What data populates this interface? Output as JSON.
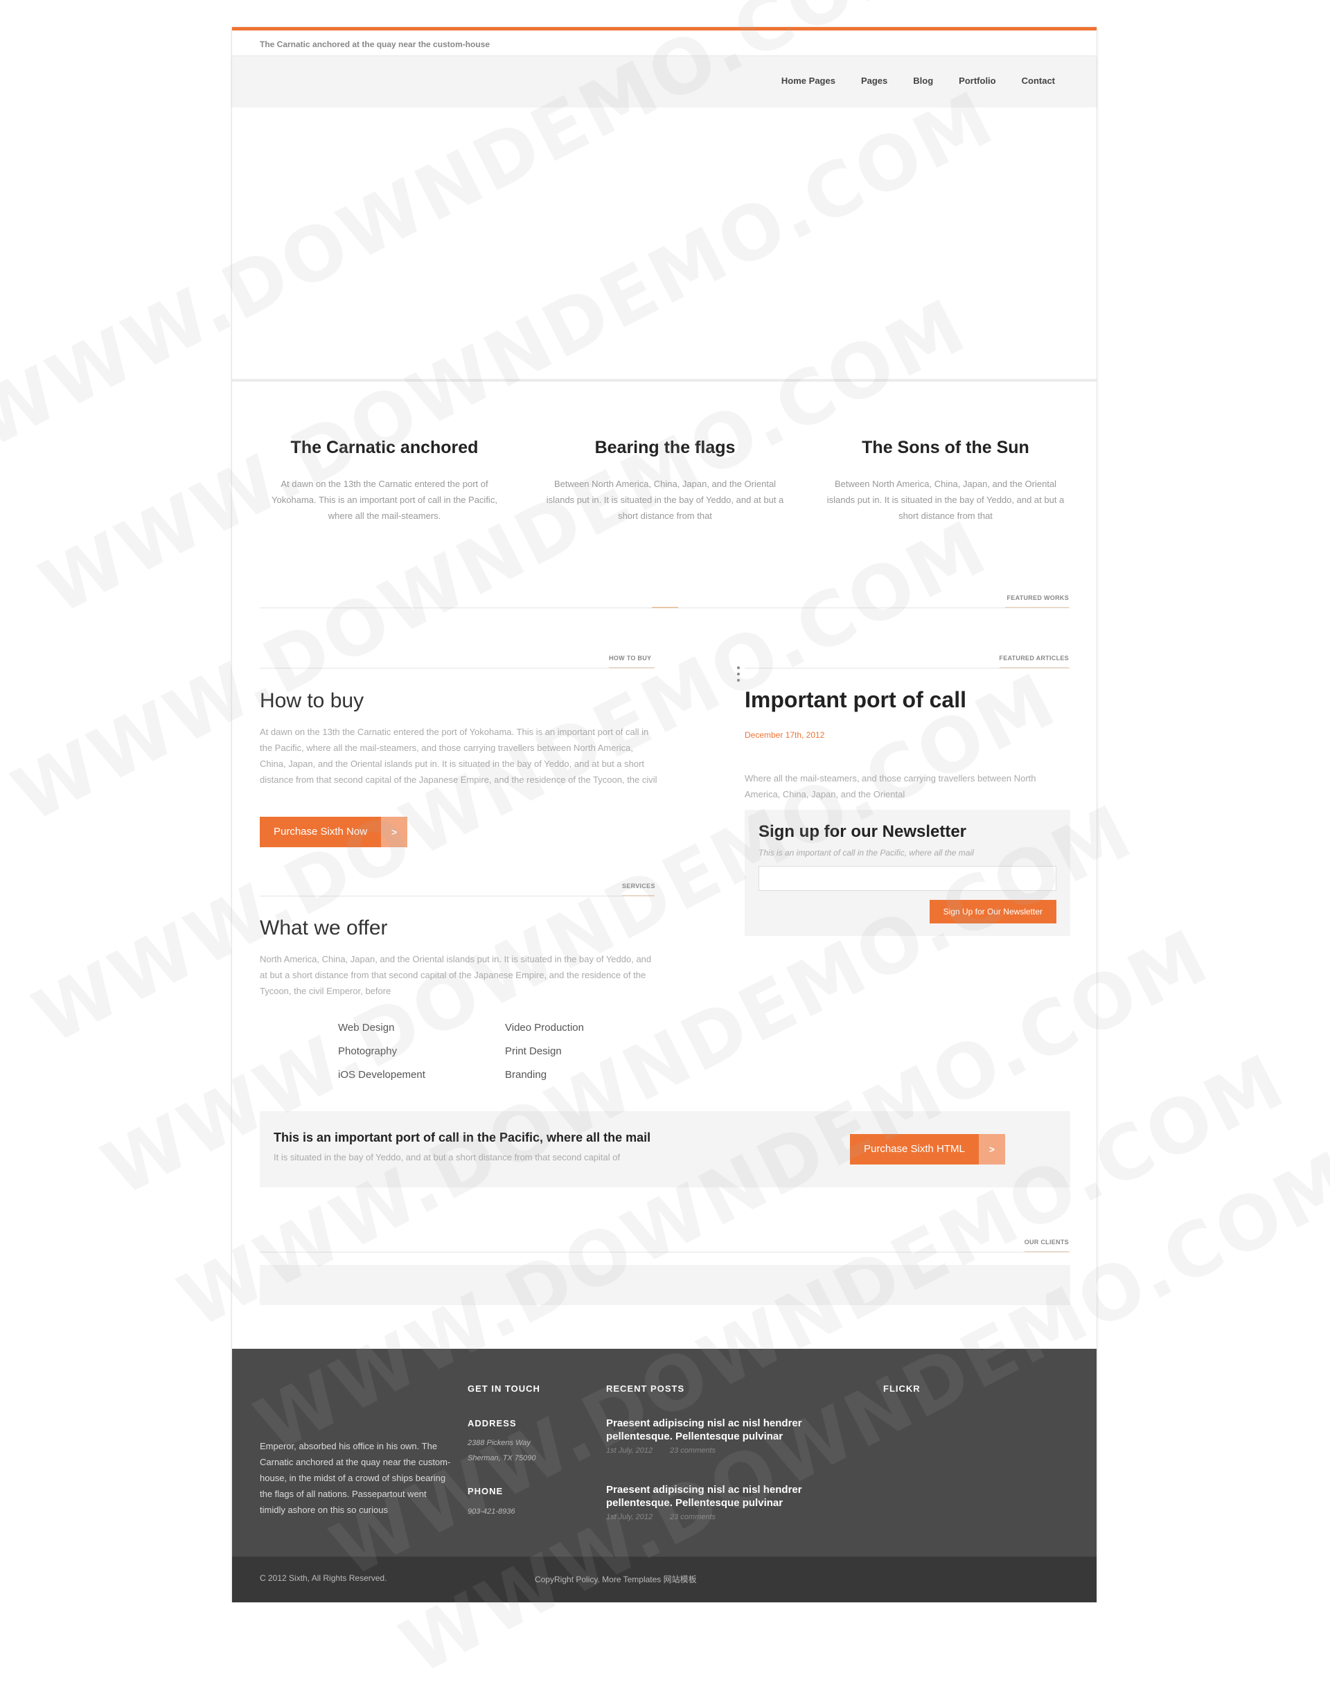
{
  "header": {
    "tagline": "The Carnatic anchored at the quay near the custom-house",
    "nav": [
      "Home Pages",
      "Pages",
      "Blog",
      "Portfolio",
      "Contact"
    ]
  },
  "features": [
    {
      "title": "The Carnatic anchored",
      "text": "At dawn on the 13th the Carnatic entered the port of Yokohama. This is an important port of call in the Pacific, where all the mail-steamers."
    },
    {
      "title": "Bearing the flags",
      "text": "Between North America, China, Japan, and the Oriental islands put in. It is situated in the bay of Yeddo, and at but a short distance from that"
    },
    {
      "title": "The Sons of the Sun",
      "text": "Between North America, China, Japan, and the Oriental islands put in. It is situated in the bay of Yeddo, and at but a short distance from that"
    }
  ],
  "labels": {
    "featured_works": "FEATURED WORKS",
    "how_to_buy": "HOW TO BUY",
    "featured_articles": "FEATURED ARTICLES",
    "services": "SERVICES",
    "our_clients": "OUR CLIENTS"
  },
  "how_to_buy": {
    "title": "How to buy",
    "text": "At dawn on the 13th the Carnatic entered the port of Yokohama. This is an important port of call in the Pacific, where all the mail-steamers, and those carrying travellers between North America, China, Japan, and the Oriental islands put in. It is situated in the bay of Yeddo, and at but a short distance from that second capital of the Japanese Empire, and the residence of the Tycoon, the civil",
    "button": "Purchase Sixth Now",
    "arrow": ">"
  },
  "offer": {
    "title": "What we offer",
    "text": "North America, China, Japan, and the Oriental islands put in. It is situated in the bay of Yeddo, and at but a short distance from that second capital of the Japanese Empire, and the residence of the Tycoon, the civil Emperor, before",
    "left_items": [
      "Web Design",
      "Photography",
      "iOS Developement"
    ],
    "right_items": [
      "Video Production",
      "Print Design",
      "Branding"
    ]
  },
  "article": {
    "title": "Important port of call",
    "date": "December 17th, 2012",
    "text": "Where all the mail-steamers, and those carrying travellers between North America, China, Japan, and the Oriental"
  },
  "newsletter": {
    "title": "Sign up for our Newsletter",
    "subtitle": "This is an important of call in the Pacific, where all the mail",
    "input_value": "",
    "button": "Sign Up for Our Newsletter"
  },
  "cta": {
    "title": "This is an important port of call in the Pacific, where all the mail",
    "subtitle": "It is situated in the bay of Yeddo, and at but a short distance from that second capital of",
    "button": "Purchase Sixth HTML",
    "arrow": ">"
  },
  "footer": {
    "about": "Emperor, absorbed his office in his own. The Carnatic anchored at the quay near the custom-house, in the midst of a crowd of ships bearing the flags of all nations. Passepartout went timidly ashore on this so curious",
    "get_in_touch": "GET IN TOUCH",
    "address_label": "ADDRESS",
    "address_line1": "2388 Pickens Way",
    "address_line2": "Sherman, TX 75090",
    "phone_label": "PHONE",
    "phone": "903-421-8936",
    "recent_posts": "RECENT POSTS",
    "posts": [
      {
        "title": "Praesent adipiscing nisl ac nisl hendrer pellentesque. Pellentesque pulvinar",
        "date": "1st July, 2012",
        "comments": "23 comments"
      },
      {
        "title": "Praesent adipiscing nisl ac nisl hendrer pellentesque. Pellentesque pulvinar",
        "date": "1st July, 2012",
        "comments": "23 comments"
      }
    ],
    "flickr": "FLICKR"
  },
  "bottom": {
    "copyright": "C 2012 Sixth, All Rights Reserved.",
    "links": "CopyRight Policy. More Templates 网站模板"
  },
  "watermark": "WWW.DOWNDEMO.COM",
  "colors": {
    "accent": "#ee7333",
    "accent_light": "#f3a882",
    "footer_bg": "#4b4b4b",
    "bottom_bg": "#383838"
  }
}
